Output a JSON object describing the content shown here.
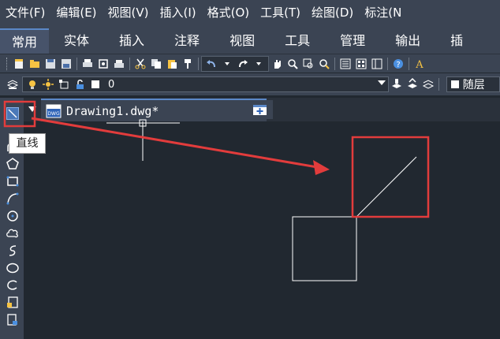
{
  "menu": [
    "文件(F)",
    "编辑(E)",
    "视图(V)",
    "插入(I)",
    "格式(O)",
    "工具(T)",
    "绘图(D)",
    "标注(N"
  ],
  "ribbon_tabs": [
    "常用",
    "实体",
    "插入",
    "注释",
    "视图",
    "工具",
    "管理",
    "输出",
    "插"
  ],
  "layer": {
    "current": "0",
    "linetype_label": "随层"
  },
  "document": {
    "title": "Drawing1.dwg*",
    "close_glyph": "✕"
  },
  "tooltip": {
    "text": "直线"
  },
  "colors": {
    "chrome": "#3b4453",
    "canvas": "#212830",
    "highlight_box": "#e23c3c",
    "arrow": "#e23c3c",
    "drawing_lines": "#ffffff",
    "active_tab_accent": "#5b88c7"
  },
  "icons": {
    "toolbar1": [
      "new-icon",
      "open-icon",
      "save-icon",
      "saveas-icon",
      "print-icon",
      "print-preview-icon",
      "plot-icon",
      "cut-icon",
      "copy-icon",
      "paste-icon",
      "match-properties-icon",
      "undo-icon",
      "redo-icon",
      "pan-icon",
      "zoom-realtime-icon",
      "zoom-window-icon",
      "zoom-previous-icon",
      "properties-icon",
      "design-center-icon",
      "tool-palette-icon",
      "help-icon"
    ],
    "left_tools": [
      "line-icon",
      "polyline-icon",
      "polygon-icon",
      "rectangle-icon",
      "arc-icon",
      "circle-icon",
      "revision-cloud-icon",
      "spline-icon",
      "ellipse-icon",
      "ellipse-arc-icon",
      "insert-block-icon",
      "make-block-icon"
    ]
  }
}
